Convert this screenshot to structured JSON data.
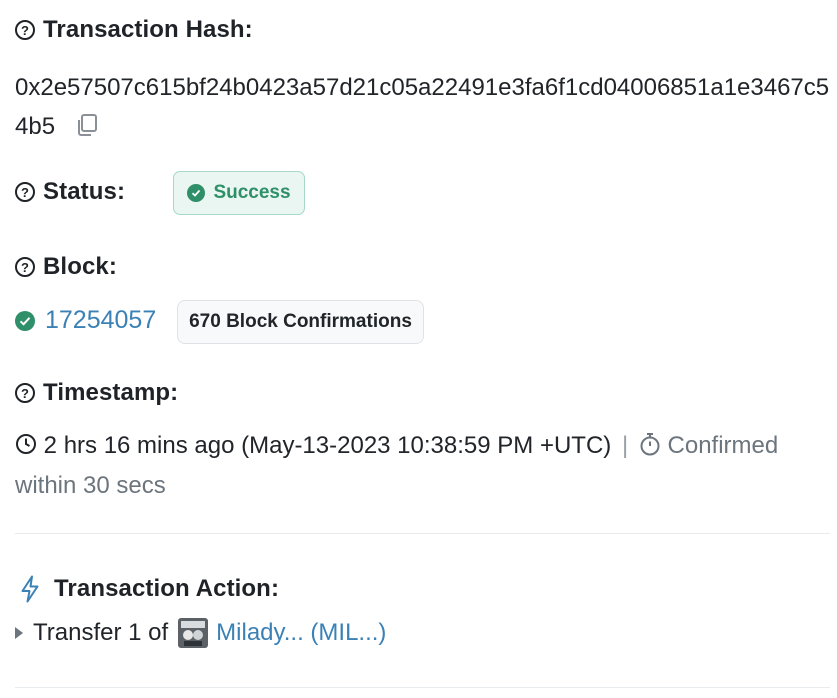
{
  "tx_hash": {
    "label": "Transaction Hash:",
    "value": "0x2e57507c615bf24b0423a57d21c05a22491e3fa6f1cd04006851a1e3467c54b5"
  },
  "status": {
    "label": "Status:",
    "badge": "Success",
    "color": "#2f8f69"
  },
  "block": {
    "label": "Block:",
    "number": "17254057",
    "confirmations": "670 Block Confirmations"
  },
  "timestamp": {
    "label": "Timestamp:",
    "relative_and_date": "2 hrs 16 mins ago (May-13-2023 10:38:59 PM +UTC)",
    "separator": "|",
    "confirmed": "Confirmed within 30 secs"
  },
  "action": {
    "label": "Transaction Action:",
    "prefix": "Transfer 1 of",
    "token_link": "Milady... (MIL...)"
  },
  "icons": {
    "help": "question-circle-icon",
    "copy": "copy-icon",
    "clock": "clock-icon",
    "stopwatch": "stopwatch-icon",
    "bolt": "lightning-bolt-icon"
  },
  "colors": {
    "link": "#3b81b5",
    "success": "#2f8f69"
  }
}
